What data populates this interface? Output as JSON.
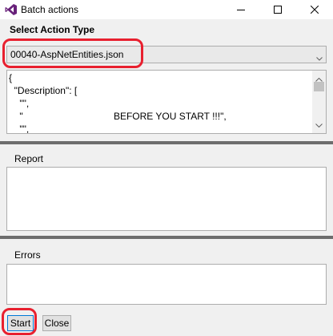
{
  "window": {
    "title": "Batch actions",
    "icon": "visual-studio-icon",
    "accent": "#68217a"
  },
  "action_type": {
    "label": "Select Action Type",
    "selected": "00040-AspNetEntities.json"
  },
  "json_preview": {
    "lines": [
      "{",
      "  \"Description\": [",
      "    \"\",",
      "    \"                                  BEFORE YOU START !!!\",",
      "    \"\","
    ]
  },
  "report": {
    "label": "Report",
    "value": ""
  },
  "errors": {
    "label": "Errors",
    "value": ""
  },
  "buttons": {
    "start": "Start",
    "close": "Close"
  },
  "colors": {
    "highlight": "#e8202f",
    "splitter": "#6d6d6d"
  }
}
